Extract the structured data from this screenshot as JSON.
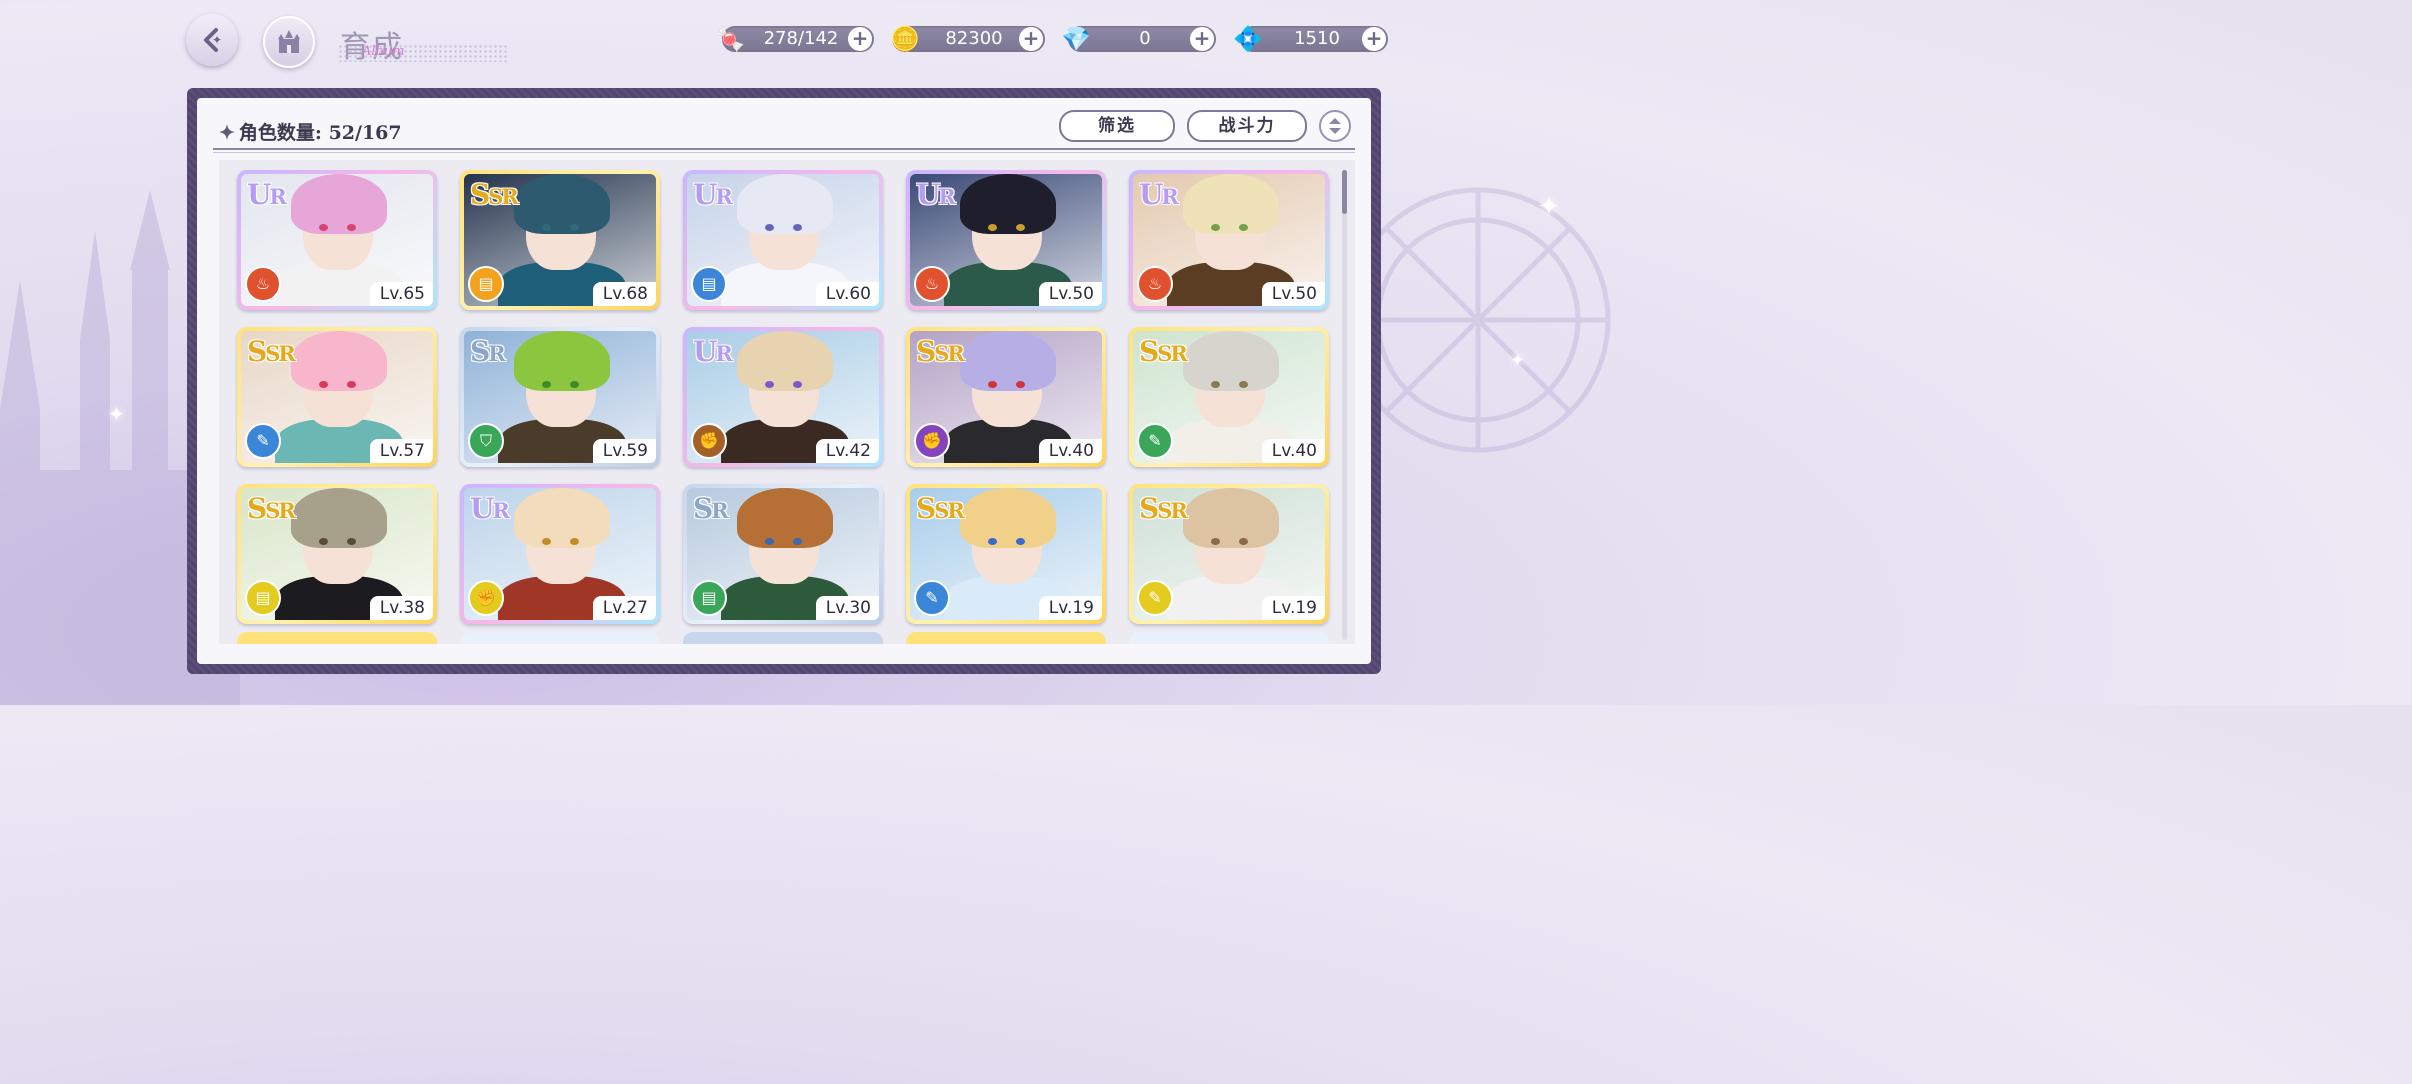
{
  "header": {
    "title": "育成",
    "title_script": "Album",
    "back_icon": "back-arrow-icon",
    "home_icon": "castle-icon"
  },
  "resources": [
    {
      "icon": "candy-icon",
      "glyph": "🍬",
      "value": "278/142"
    },
    {
      "icon": "gold-coin-icon",
      "glyph": "🪙",
      "value": "82300"
    },
    {
      "icon": "rainbow-gem-icon",
      "glyph": "💎",
      "value": "0"
    },
    {
      "icon": "blue-diamond-icon",
      "glyph": "💠",
      "value": "1510"
    }
  ],
  "panel": {
    "count_label": "角色数量:",
    "count_value": "52/167",
    "filter_label": "筛选",
    "sort_label": "战斗力"
  },
  "colors": {
    "ur": "#b39cf2",
    "ssr": "#e5a91c",
    "sr": "#8da6c8",
    "panel_border": "#5b4e79"
  },
  "cards": [
    {
      "rarity": "UR",
      "level": "Lv.65",
      "element": "fire",
      "elem_color": "#e0512e",
      "hair": "#e7a6d8",
      "outfit": "#f2f2f2",
      "bg": "#e3e6ef",
      "eyes": "#d8446d"
    },
    {
      "rarity": "SSR",
      "level": "Lv.68",
      "element": "book",
      "elem_color": "#f2a21c",
      "hair": "#2e5a70",
      "outfit": "#1d5f78",
      "bg": "#24344e",
      "eyes": "#2f6a7a"
    },
    {
      "rarity": "UR",
      "level": "Lv.60",
      "element": "book",
      "elem_color": "#3c86d8",
      "hair": "#e6e9f4",
      "outfit": "#f4f6fb",
      "bg": "#c7d3ea",
      "eyes": "#6a62b8"
    },
    {
      "rarity": "UR",
      "level": "Lv.50",
      "element": "fire",
      "elem_color": "#e0512e",
      "hair": "#1e1e2c",
      "outfit": "#2c5a4a",
      "bg": "#3a4a78",
      "eyes": "#c9a030"
    },
    {
      "rarity": "UR",
      "level": "Lv.50",
      "element": "fire",
      "elem_color": "#e0512e",
      "hair": "#efe1b8",
      "outfit": "#5a3d22",
      "bg": "#e4c9b0",
      "eyes": "#74a049"
    },
    {
      "rarity": "SSR",
      "level": "Lv.57",
      "element": "tool",
      "elem_color": "#3c86d8",
      "hair": "#f7b6cc",
      "outfit": "#6bb7b4",
      "bg": "#e8d7c7",
      "eyes": "#d83a5a"
    },
    {
      "rarity": "SR",
      "level": "Lv.59",
      "element": "shield",
      "elem_color": "#3aa65a",
      "hair": "#8cc63f",
      "outfit": "#4a3b2a",
      "bg": "#8fb2d8",
      "eyes": "#3f8a2a"
    },
    {
      "rarity": "UR",
      "level": "Lv.42",
      "element": "fist",
      "elem_color": "#a56028",
      "hair": "#e8d3b0",
      "outfit": "#3a2a22",
      "bg": "#a9cde6",
      "eyes": "#7a5ac8"
    },
    {
      "rarity": "SSR",
      "level": "Lv.40",
      "element": "fist",
      "elem_color": "#8444c0",
      "hair": "#b8aee6",
      "outfit": "#2a2a2e",
      "bg": "#b4a2c6",
      "eyes": "#d0343a"
    },
    {
      "rarity": "SSR",
      "level": "Lv.40",
      "element": "tool",
      "elem_color": "#3aa65a",
      "hair": "#d6d4cd",
      "outfit": "#f1efe8",
      "bg": "#cfe4d0",
      "eyes": "#8a7a4a"
    },
    {
      "rarity": "SSR",
      "level": "Lv.38",
      "element": "book",
      "elem_color": "#e4cc1f",
      "hair": "#a7a08a",
      "outfit": "#1c1c20",
      "bg": "#d9e6c9",
      "eyes": "#5a4a3a"
    },
    {
      "rarity": "UR",
      "level": "Lv.27",
      "element": "fist",
      "elem_color": "#e4cc1f",
      "hair": "#f3dcbc",
      "outfit": "#a03626",
      "bg": "#bcd4ea",
      "eyes": "#c48a2a"
    },
    {
      "rarity": "SR",
      "level": "Lv.30",
      "element": "book",
      "elem_color": "#3aa65a",
      "hair": "#b66f35",
      "outfit": "#2c5a3a",
      "bg": "#b7cadf",
      "eyes": "#3a6ab0"
    },
    {
      "rarity": "SSR",
      "level": "Lv.19",
      "element": "tool",
      "elem_color": "#3c86d8",
      "hair": "#f1d089",
      "outfit": "#d9eaf8",
      "bg": "#a8cdea",
      "eyes": "#3a6ad0"
    },
    {
      "rarity": "SSR",
      "level": "Lv.19",
      "element": "tool",
      "elem_color": "#e4cc1f",
      "hair": "#dcc3a2",
      "outfit": "#f1f1f1",
      "bg": "#cfe0d6",
      "eyes": "#8a6a4a"
    }
  ],
  "peek_colors": [
    "#ffe27a",
    "#eaf1fb",
    "#c7d6ec",
    "#ffe27a",
    "#eaf1fb"
  ]
}
